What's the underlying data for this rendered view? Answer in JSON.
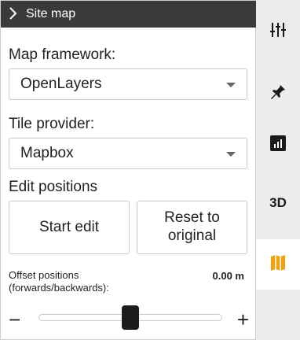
{
  "header": {
    "title": "Site map"
  },
  "map_framework": {
    "label": "Map framework:",
    "value": "OpenLayers"
  },
  "tile_provider": {
    "label": "Tile provider:",
    "value": "Mapbox"
  },
  "edit_positions": {
    "label": "Edit positions",
    "start_label": "Start edit",
    "reset_label_line1": "Reset to",
    "reset_label_line2": "original"
  },
  "offset": {
    "label_line1": "Offset positions",
    "label_line2": "(forwards/backwards):",
    "value": "0.00 m",
    "minus": "−",
    "plus": "+",
    "level": 0.5
  },
  "rail": {
    "items": [
      {
        "name": "sliders-icon",
        "active": false
      },
      {
        "name": "pin-icon",
        "active": false
      },
      {
        "name": "bar-chart-icon",
        "active": false
      },
      {
        "name": "3d",
        "label": "3D",
        "active": false
      },
      {
        "name": "map-icon",
        "active": true
      }
    ]
  },
  "colors": {
    "header_bg": "#3a3a3a",
    "accent": "#f0a30a"
  }
}
